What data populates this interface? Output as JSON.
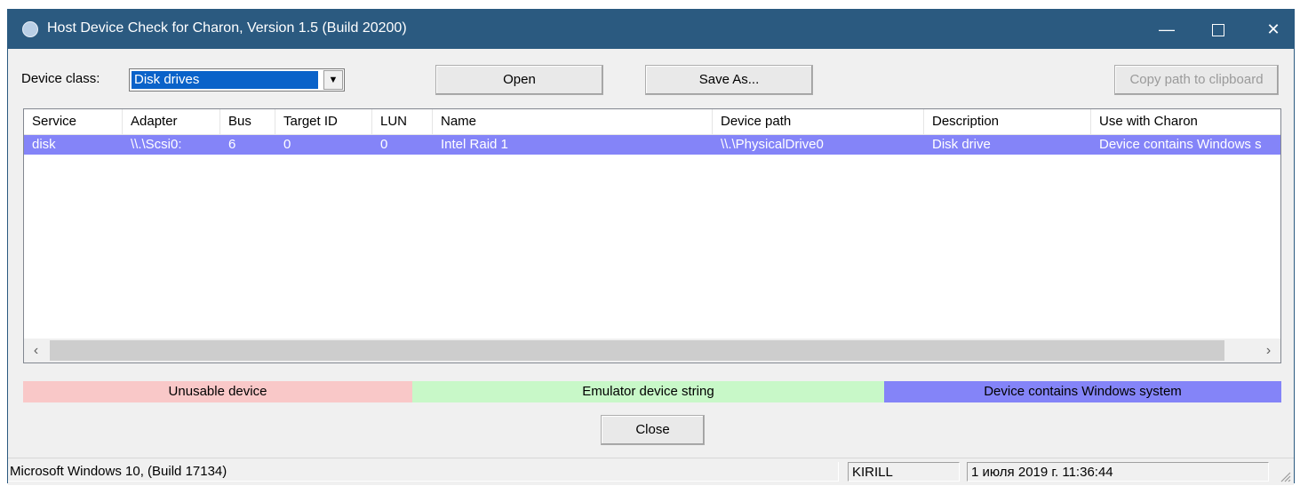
{
  "window": {
    "title": "Host Device Check for Charon, Version 1.5 (Build 20200)",
    "controls": {
      "minimize": "—",
      "close": "✕"
    }
  },
  "toolbar": {
    "device_class_label": "Device class:",
    "device_class_value": "Disk drives",
    "open_label": "Open",
    "save_as_label": "Save As...",
    "copy_path_label": "Copy path to clipboard"
  },
  "table": {
    "columns": [
      "Service",
      "Adapter",
      "Bus",
      "Target ID",
      "LUN",
      "Name",
      "Device path",
      "Description",
      "Use with Charon"
    ],
    "rows": [
      [
        "disk",
        "\\\\.\\Scsi0:",
        "6",
        "0",
        "0",
        "Intel Raid 1",
        "\\\\.\\PhysicalDrive0",
        "Disk drive",
        "Device contains Windows s"
      ]
    ],
    "scroll_left": "‹",
    "scroll_right": "›"
  },
  "legend": {
    "unusable": "Unusable device",
    "emulator": "Emulator device string",
    "windows_system": "Device contains Windows system"
  },
  "colors": {
    "titlebar": "#2b5a80",
    "unusable": "#f9c8c8",
    "emulator": "#c8f8c8",
    "windows_system": "#8484f8",
    "selection": "#0a62c9"
  },
  "close_label": "Close",
  "status": {
    "os": "Microsoft Windows 10,  (Build 17134)",
    "host": "KIRILL",
    "datetime": "1 июля 2019 г. 11:36:44"
  }
}
